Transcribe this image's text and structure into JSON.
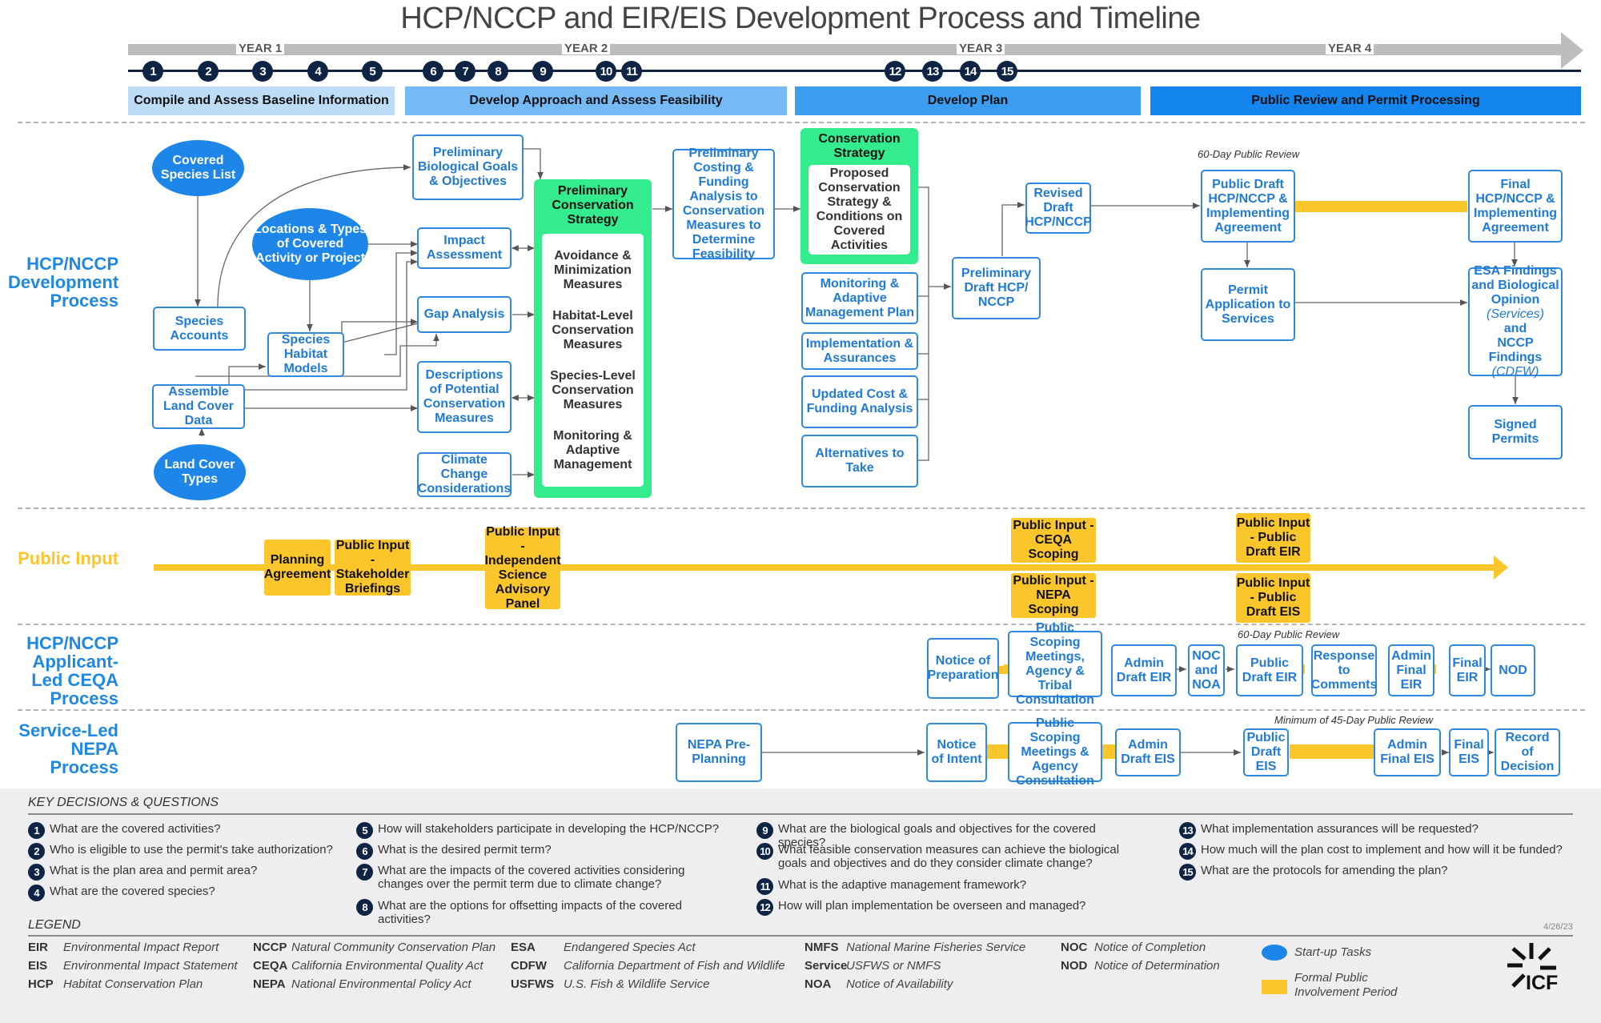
{
  "title": "HCP/NCCP and EIR/EIS Development Process and Timeline",
  "timeline": {
    "years": [
      "YEAR 1",
      "YEAR 2",
      "YEAR 3",
      "YEAR 4"
    ],
    "milestones": [
      "1",
      "2",
      "3",
      "4",
      "5",
      "6",
      "7",
      "8",
      "9",
      "10",
      "11",
      "12",
      "13",
      "14",
      "15"
    ],
    "phases": [
      "Compile and Assess Baseline Information",
      "Develop Approach and Assess Feasibility",
      "Develop Plan",
      "Public Review and Permit Processing"
    ]
  },
  "lanes": {
    "hcp": "HCP/NCCP Development Process",
    "public": "Public Input",
    "ceqa": "HCP/NCCP Applicant-Led CEQA Process",
    "nepa": "Service-Led NEPA Process"
  },
  "hcp": {
    "covered_species_list": "Covered Species List",
    "locations_types": "Locations & Types of Covered Activity or Project",
    "land_cover_types": "Land Cover Types",
    "species_accounts": "Species Accounts",
    "species_habitat_models": "Species Habitat Models",
    "assemble_land_cover": "Assemble Land Cover Data",
    "prelim_bio_goals": "Preliminary Biological Goals & Objectives",
    "impact_assessment": "Impact Assessment",
    "gap_analysis": "Gap Analysis",
    "descriptions_measures": "Descriptions of Potential Conservation Measures",
    "climate_change": "Climate Change Considerations",
    "prelim_cons_strategy": {
      "title": "Preliminary Conservation Strategy",
      "items": [
        "Avoidance & Minimization Measures",
        "Habitat-Level Conservation Measures",
        "Species-Level Conservation Measures",
        "Monitoring & Adaptive Management"
      ]
    },
    "prelim_costing": "Preliminary Costing & Funding Analysis to Conservation Measures to Determine Feasibility",
    "cons_strategy": {
      "title": "Conservation Strategy",
      "inner": "Proposed Conservation Strategy & Conditions on Covered Activities"
    },
    "monitoring_plan": "Monitoring & Adaptive Management Plan",
    "implementation": "Implementation & Assurances",
    "updated_cost": "Updated Cost & Funding Analysis",
    "alternatives": "Alternatives to Take",
    "prelim_draft": "Preliminary Draft HCP/ NCCP",
    "revised_draft": "Revised Draft HCP/NCCP",
    "review_note": "60-Day Public Review",
    "public_draft": "Public Draft HCP/NCCP & Implementing Agreement",
    "final_hcp": "Final HCP/NCCP & Implementing Agreement",
    "permit_application": "Permit Application to Services",
    "esa_findings": {
      "line1": "ESA Findings and Biological Opinion",
      "services": "(Services)",
      "and": "and",
      "line2": "NCCP Findings",
      "cdfw": "(CDFW)"
    },
    "signed_permits": "Signed Permits"
  },
  "public_input": {
    "planning_agreement": "Planning Agreement",
    "stakeholder": "Public Input - Stakeholder Briefings",
    "science_panel": "Public Input - Independent Science Advisory Panel",
    "ceqa_scoping": "Public Input - CEQA Scoping",
    "nepa_scoping": "Public Input - NEPA Scoping",
    "draft_eir": "Public Input - Public Draft EIR",
    "draft_eis": "Public Input - Public Draft EIS"
  },
  "ceqa": {
    "note": "60-Day Public Review",
    "steps": [
      "Notice of Preparation",
      "Public Scoping Meetings, Agency & Tribal Consultation",
      "Admin Draft EIR",
      "NOC and NOA",
      "Public Draft EIR",
      "Response to Comments",
      "Admin Final EIR",
      "Final EIR",
      "NOD"
    ]
  },
  "nepa": {
    "note": "Minimum of 45-Day Public Review",
    "steps": [
      "NEPA Pre-Planning",
      "Notice of Intent",
      "Public Scoping Meetings & Agency Consultation",
      "Admin Draft EIS",
      "Public Draft EIS",
      "Admin Final EIS",
      "Final EIS",
      "Record of Decision"
    ]
  },
  "questions": {
    "heading": "KEY DECISIONS & QUESTIONS",
    "items": [
      {
        "n": "1",
        "text": "What are the covered activities?"
      },
      {
        "n": "2",
        "text": "Who is eligible to use the permit's take authorization?"
      },
      {
        "n": "3",
        "text": "What is the plan area and permit area?"
      },
      {
        "n": "4",
        "text": "What are the covered species?"
      },
      {
        "n": "5",
        "text": "How will stakeholders participate in developing the HCP/NCCP?"
      },
      {
        "n": "6",
        "text": "What is the desired permit term?"
      },
      {
        "n": "7",
        "text": "What are the impacts of the covered activities considering changes over the permit term due to climate change?"
      },
      {
        "n": "8",
        "text": "What are the options for offsetting impacts of the covered activities?"
      },
      {
        "n": "9",
        "text": "What are the biological goals and objectives for the covered species?"
      },
      {
        "n": "10",
        "text": "What feasible conservation measures can achieve the biological goals and objectives and do they consider climate change?"
      },
      {
        "n": "11",
        "text": "What is the adaptive management framework?"
      },
      {
        "n": "12",
        "text": "How will plan implementation be overseen and managed?"
      },
      {
        "n": "13",
        "text": "What implementation assurances will be requested?"
      },
      {
        "n": "14",
        "text": "How much will the plan cost to implement and how will it be funded?"
      },
      {
        "n": "15",
        "text": "What are the protocols for amending the plan?"
      }
    ]
  },
  "legend": {
    "heading": "LEGEND",
    "date": "4/26/23",
    "abbreviations": [
      {
        "abbr": "EIR",
        "def": "Environmental Impact Report"
      },
      {
        "abbr": "EIS",
        "def": "Environmental Impact Statement"
      },
      {
        "abbr": "HCP",
        "def": "Habitat Conservation Plan"
      },
      {
        "abbr": "NCCP",
        "def": "Natural Community Conservation Plan"
      },
      {
        "abbr": "CEQA",
        "def": "California Environmental Quality Act"
      },
      {
        "abbr": "NEPA",
        "def": "National Environmental Policy Act"
      },
      {
        "abbr": "ESA",
        "def": "Endangered Species Act"
      },
      {
        "abbr": "CDFW",
        "def": "California Department of Fish and Wildlife"
      },
      {
        "abbr": "USFWS",
        "def": "U.S. Fish & Wildlife Service"
      },
      {
        "abbr": "NMFS",
        "def": "National Marine Fisheries Service"
      },
      {
        "abbr": "Service",
        "def": "USFWS or NMFS"
      },
      {
        "abbr": "NOA",
        "def": "Notice of Availability"
      },
      {
        "abbr": "NOC",
        "def": "Notice of Completion"
      },
      {
        "abbr": "NOD",
        "def": "Notice of Determination"
      }
    ],
    "symbols": {
      "startup": "Start-up Tasks",
      "formal": "Formal Public Involvement Period"
    },
    "logo": "ICF"
  },
  "colors": {
    "accent_blue": "#1e86e8",
    "green": "#33ec8e",
    "yellow": "#fbc62b",
    "navy": "#0d2445"
  }
}
